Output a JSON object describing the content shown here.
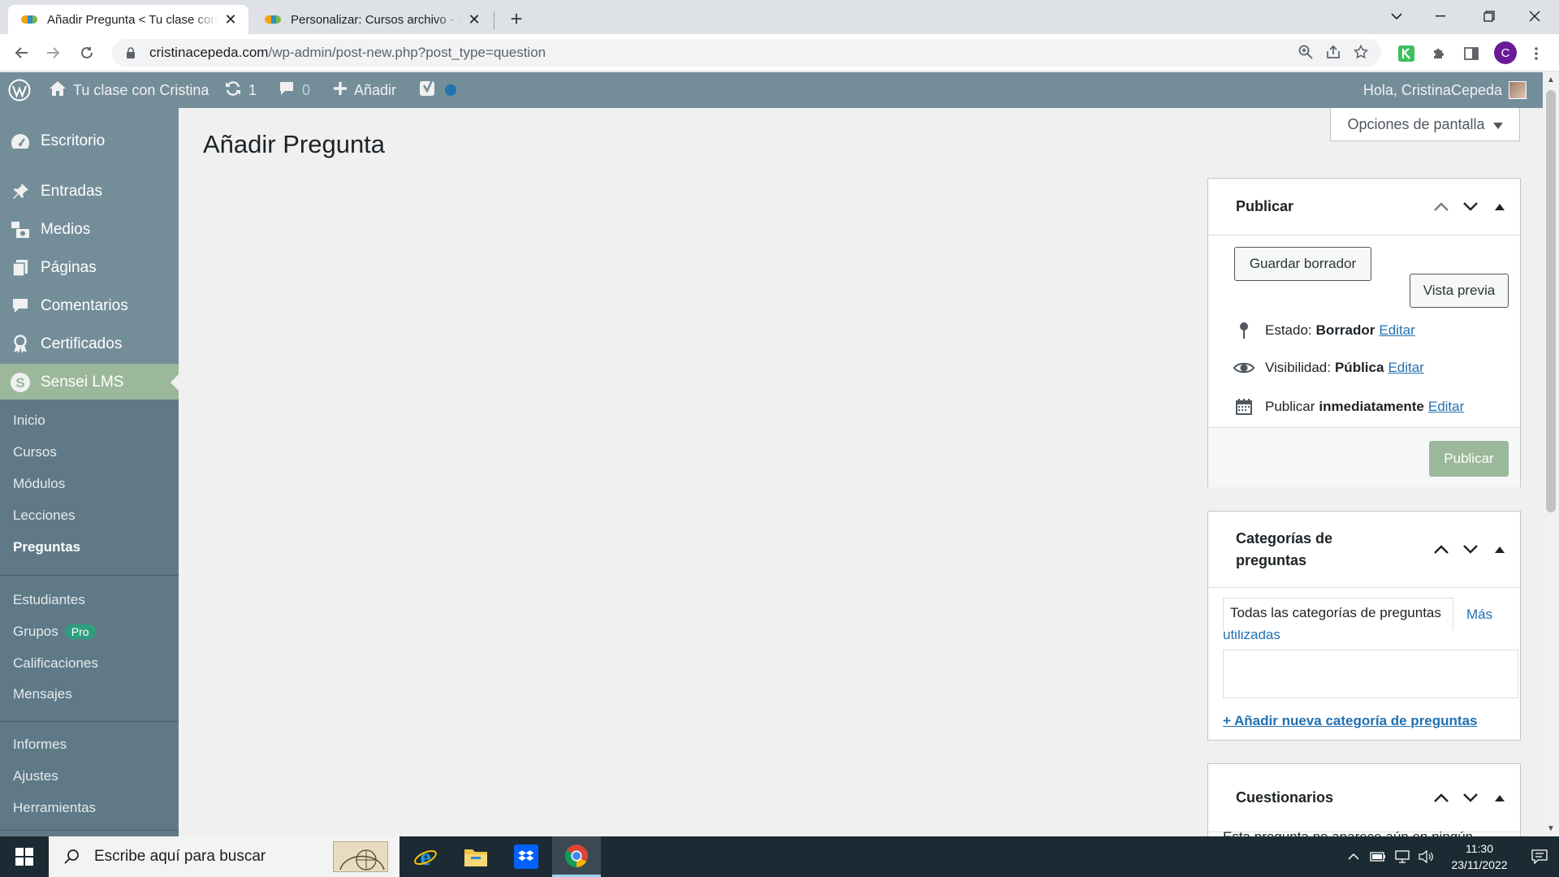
{
  "browser": {
    "tabs": [
      {
        "title": "Añadir Pregunta < Tu clase con Cristina",
        "active": true
      },
      {
        "title": "Personalizar: Cursos archivo - Tu clase con Cristina",
        "active": false
      }
    ],
    "url_host": "cristinacepeda.com",
    "url_path": "/wp-admin/post-new.php?post_type=question",
    "profile_initial": "C"
  },
  "admin_bar": {
    "site_name": "Tu clase con Cristina",
    "updates_count": "1",
    "comments_count": "0",
    "new_label": "Añadir",
    "greeting": "Hola, CristinaCepeda"
  },
  "sidebar": {
    "top_items": [
      {
        "label": "Escritorio",
        "icon": "dashboard-icon"
      },
      {
        "label": "Entradas",
        "icon": "pin-icon"
      },
      {
        "label": "Medios",
        "icon": "media-icon"
      },
      {
        "label": "Páginas",
        "icon": "pages-icon"
      },
      {
        "label": "Comentarios",
        "icon": "comment-icon"
      },
      {
        "label": "Certificados",
        "icon": "award-icon"
      },
      {
        "label": "Sensei LMS",
        "icon": "sensei-icon",
        "current": true
      }
    ],
    "sub_group_1": [
      "Inicio",
      "Cursos",
      "Módulos",
      "Lecciones",
      "Preguntas"
    ],
    "sub_group_2": [
      "Estudiantes",
      "Grupos",
      "Calificaciones",
      "Mensajes"
    ],
    "sub_group_3": [
      "Informes",
      "Ajustes",
      "Herramientas"
    ],
    "pro_badge": "Pro",
    "current_sub": "Preguntas"
  },
  "page": {
    "title": "Añadir Pregunta",
    "screen_options": "Opciones de pantalla"
  },
  "publish_box": {
    "title": "Publicar",
    "save_draft": "Guardar borrador",
    "preview": "Vista previa",
    "status_label": "Estado:",
    "status_value": "Borrador",
    "visibility_label": "Visibilidad:",
    "visibility_value": "Pública",
    "publish_label": "Publicar",
    "publish_value": "inmediatamente",
    "edit_link": "Editar",
    "publish_button": "Publicar"
  },
  "categories_box": {
    "title_line1": "Categorías de",
    "title_line2": "preguntas",
    "tab_all": "Todas las categorías de preguntas",
    "tab_most_used_1": "Más",
    "tab_most_used_2": "utilizadas",
    "add_new": "+ Añadir nueva categoría de preguntas"
  },
  "quizzes_box": {
    "title": "Cuestionarios",
    "partial_text": "Esta pregunta no aparece aún en ningún"
  },
  "taskbar": {
    "search_placeholder": "Escribe aquí para buscar",
    "time": "11:30",
    "date": "23/11/2022"
  },
  "colors": {
    "admin_bar": "#748e99",
    "sidebar": "#748e99",
    "submenu": "#5f7a86",
    "current_menu": "#9bb89a",
    "link": "#2271b1",
    "primary_button": "#9bb89a"
  }
}
